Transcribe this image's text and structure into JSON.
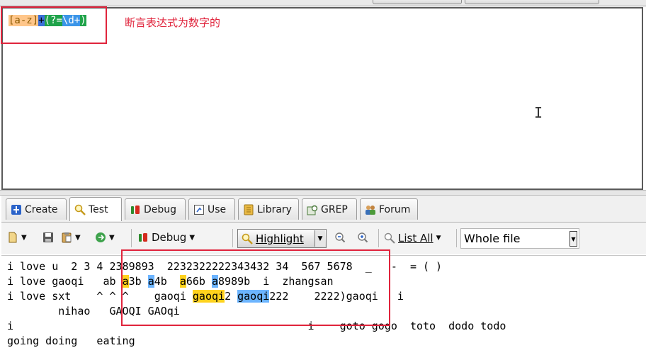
{
  "regex": {
    "tokens": [
      "[a-z]",
      "+",
      "(?=",
      "\\d+",
      ")"
    ],
    "annotation": "断言表达式为数字的"
  },
  "tabs": [
    {
      "label": "Create",
      "icon": "create-icon"
    },
    {
      "label": "Test",
      "icon": "test-magnifier-icon",
      "active": true
    },
    {
      "label": "Debug",
      "icon": "debug-bug-icon"
    },
    {
      "label": "Use",
      "icon": "use-icon"
    },
    {
      "label": "Library",
      "icon": "library-icon"
    },
    {
      "label": "GREP",
      "icon": "grep-icon"
    },
    {
      "label": "Forum",
      "icon": "forum-users-icon"
    }
  ],
  "toolbar": {
    "debug_label": "Debug",
    "highlight_label": "Highlight",
    "list_all_label": "List All",
    "scope_value": "Whole file"
  },
  "test_text": {
    "line1": "i love u  2 3 4 2389893  2232322222343432 34  567 5678  _   -  = ( )",
    "line2": {
      "p1": "i love gaoqi   ab ",
      "m1": "a",
      "p2": "3b ",
      "m2": "a",
      "p3": "4b  ",
      "m3": "a",
      "p4": "66b ",
      "m4": "a",
      "p5": "8989b  i  zhangsan"
    },
    "line3": {
      "p1": "i love sxt    ^ ^ ^    gaoqi ",
      "m1": "gaoqi",
      "p2": "2 ",
      "m2": "gaoqi",
      "p3": "222    2222)gaoqi   i"
    },
    "line4": "        nihao   GAOQI GAOqi",
    "line5": "i                                              i    goto gogo  toto  dodo todo",
    "line6": "going doing   eating"
  },
  "colors": {
    "match_primary": "#ffd21e",
    "match_alternate": "#6cb4ff",
    "annotation_red": "#e0243c"
  }
}
